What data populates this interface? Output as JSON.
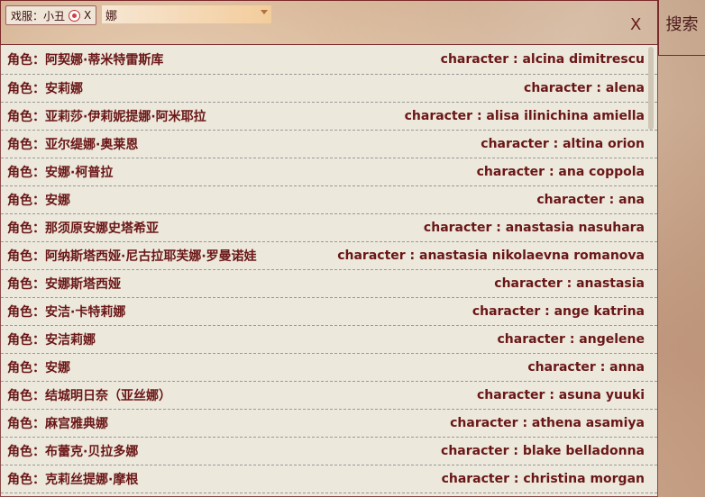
{
  "search": {
    "tag_text": "戏服：小丑",
    "tag_remove": "X",
    "query": "娜",
    "close_label": "X",
    "button_label": "搜索"
  },
  "results": [
    {
      "left": "角色：阿契娜·蒂米特雷斯库",
      "right": "character : alcina dimitrescu"
    },
    {
      "left": "角色：安莉娜",
      "right": "character : alena"
    },
    {
      "left": "角色：亚莉莎·伊莉妮提娜·阿米耶拉",
      "right": "character : alisa ilinichina amiella"
    },
    {
      "left": "角色：亚尔缇娜·奥莱恩",
      "right": "character : altina orion"
    },
    {
      "left": "角色：安娜·柯普拉",
      "right": "character : ana coppola"
    },
    {
      "left": "角色：安娜",
      "right": "character : ana"
    },
    {
      "left": "角色：那须原安娜史塔希亚",
      "right": "character : anastasia nasuhara"
    },
    {
      "left": "角色：阿纳斯塔西娅·尼古拉耶芙娜·罗曼诺娃",
      "right": "character : anastasia nikolaevna romanova"
    },
    {
      "left": "角色：安娜斯塔西娅",
      "right": "character : anastasia"
    },
    {
      "left": "角色：安洁·卡特莉娜",
      "right": "character : ange katrina"
    },
    {
      "left": "角色：安洁莉娜",
      "right": "character : angelene"
    },
    {
      "left": "角色：安娜",
      "right": "character : anna"
    },
    {
      "left": "角色：结城明日奈（亚丝娜）",
      "right": "character : asuna yuuki"
    },
    {
      "left": "角色：麻宫雅典娜",
      "right": "character : athena asamiya"
    },
    {
      "left": "角色：布蕾克·贝拉多娜",
      "right": "character : blake belladonna"
    },
    {
      "left": "角色：克莉丝提娜·摩根",
      "right": "character : christina morgan"
    }
  ]
}
